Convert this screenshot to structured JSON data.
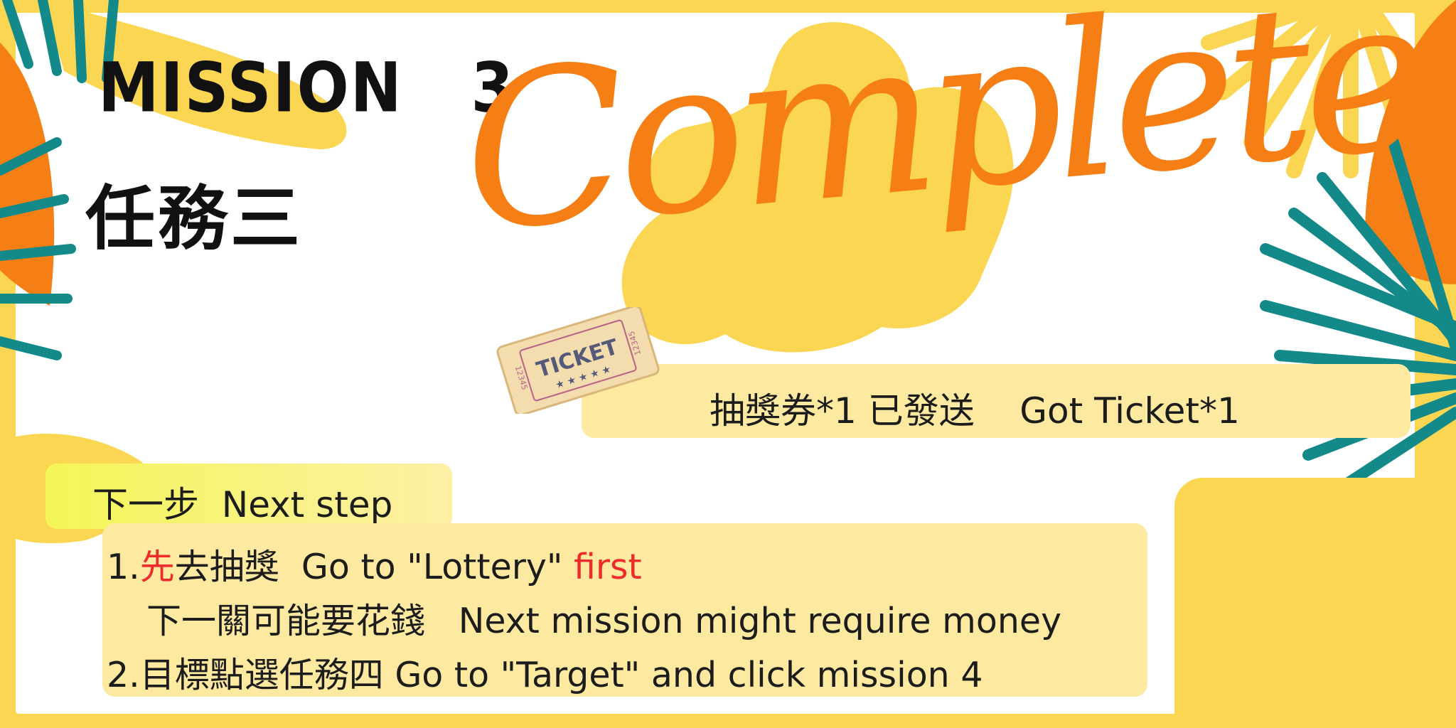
{
  "mission": {
    "title": "MISSION   3",
    "title_cn": "任務三"
  },
  "complete": {
    "word": "Complete"
  },
  "ticket": {
    "icon_text": "TICKET",
    "icon_number": "12345",
    "banner_text": "抽獎券*1 已發送    Got Ticket*1"
  },
  "next_step": {
    "label": "下一步  Next step"
  },
  "steps": {
    "line1_prefix": "1.",
    "line1_red_cn": "先",
    "line1_text": "去抽獎  Go to \"Lottery\" ",
    "line1_red_en": "first",
    "line2_text": "下一關可能要花錢   Next mission might require money",
    "line3_text": "2.目標點選任務四 Go to \"Target\" and click mission 4"
  },
  "colors": {
    "background": "#fbd652",
    "card": "#ffffff",
    "accent_orange": "#f57f14",
    "leaf_teal": "#13898a",
    "banner": "#fde9a0",
    "highlight_red": "#ee2b2b"
  }
}
